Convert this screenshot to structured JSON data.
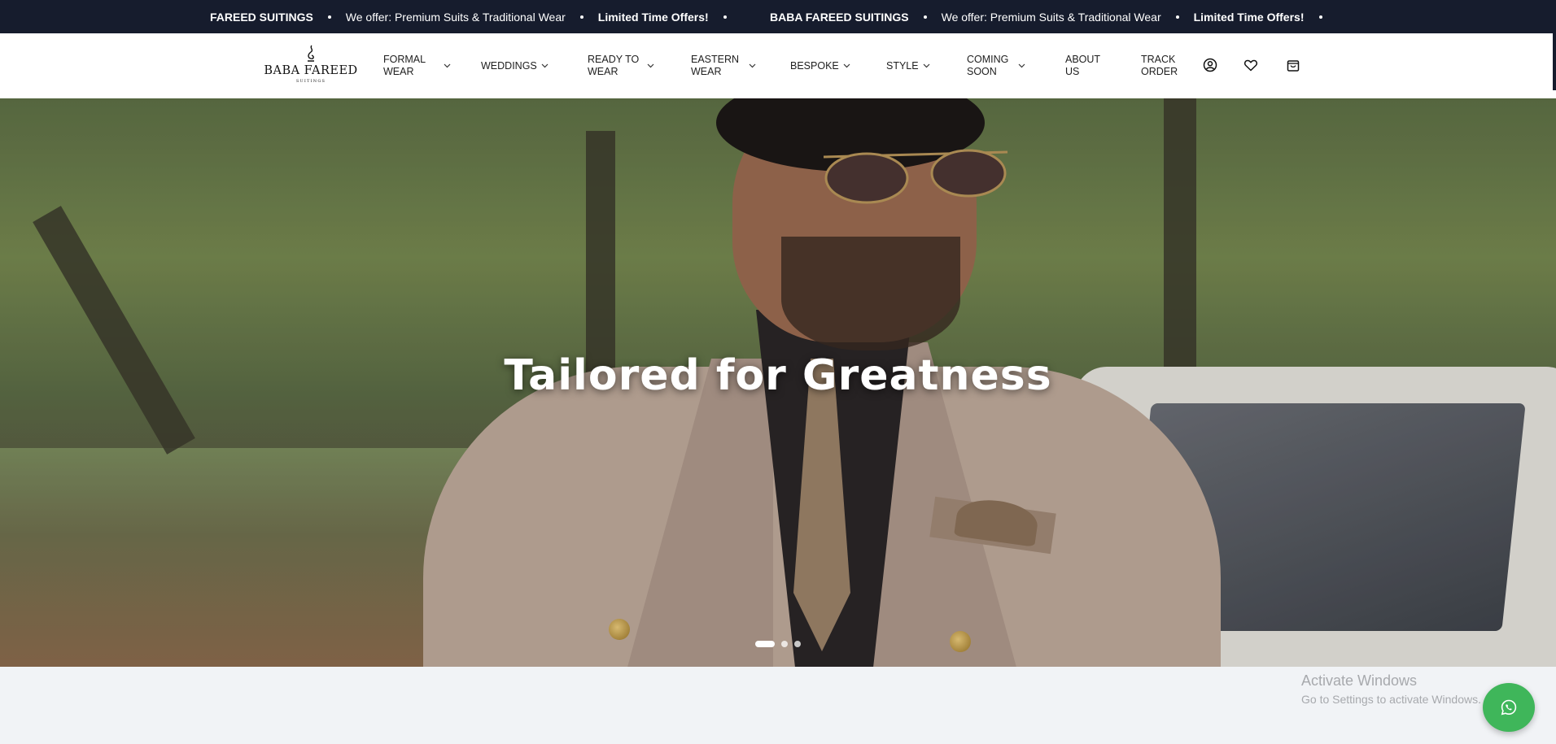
{
  "announcement": {
    "groups": [
      {
        "brand": "FAREED SUITINGS",
        "offer": "We offer: Premium Suits & Traditional Wear",
        "promo": "Limited Time Offers!"
      },
      {
        "brand": "BABA FAREED SUITINGS",
        "offer": "We offer: Premium Suits & Traditional Wear",
        "promo": "Limited Time Offers!"
      }
    ]
  },
  "logo": {
    "name": "BABA FAREED",
    "sub": "SUITINGS"
  },
  "nav": [
    {
      "line1": "FORMAL",
      "line2": "WEAR"
    },
    {
      "line1": "WEDDINGS",
      "line2": ""
    },
    {
      "line1": "READY TO",
      "line2": "WEAR"
    },
    {
      "line1": "EASTERN",
      "line2": "WEAR"
    },
    {
      "line1": "BESPOKE",
      "line2": ""
    },
    {
      "line1": "STYLE",
      "line2": ""
    },
    {
      "line1": "COMING",
      "line2": "SOON"
    },
    {
      "line1": "ABOUT",
      "line2": "US"
    },
    {
      "line1": "TRACK",
      "line2": "ORDER"
    }
  ],
  "icons": {
    "account": "user-icon",
    "wishlist": "heart-icon",
    "cart": "bag-icon",
    "chat": "whatsapp-icon"
  },
  "hero": {
    "title": "Tailored for Greatness",
    "slides_total": 3,
    "active_slide": 1
  },
  "watermark": {
    "line1": "Activate Windows",
    "line2": "Go to Settings to activate Windows."
  },
  "colors": {
    "topbar": "#161c2d",
    "whatsapp": "#3fb65a",
    "page_bg": "#f1f3f6"
  }
}
